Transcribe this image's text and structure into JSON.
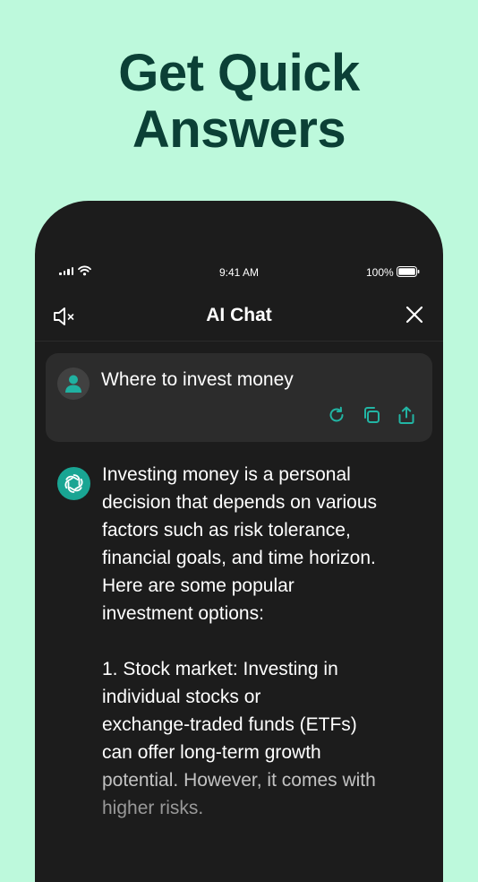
{
  "headline": {
    "line1": "Get Quick",
    "line2": "Answers"
  },
  "status_bar": {
    "time": "9:41 AM",
    "battery": "100%"
  },
  "nav": {
    "title": "AI Chat"
  },
  "user_message": {
    "text": "Where to invest money"
  },
  "ai_message": {
    "intro_lines": [
      "Investing money is a personal",
      "decision that depends on various",
      "factors such as risk tolerance,",
      "financial goals, and time horizon.",
      "Here are some popular",
      "investment options:"
    ],
    "item_lines": [
      "1. Stock market: Investing in",
      "individual stocks or",
      "exchange-traded funds (ETFs)",
      "can offer long-term growth",
      "potential. However, it comes with",
      "higher risks."
    ]
  },
  "colors": {
    "background": "#bdf9dc",
    "headline": "#0b4036",
    "phone": "#1c1c1c",
    "card": "#2c2c2c",
    "accent": "#19a593",
    "icon_accent": "#22b5a4"
  },
  "icons": {
    "nav_left": "speaker-mute-icon",
    "nav_right": "close-icon",
    "actions": [
      "refresh-icon",
      "copy-icon",
      "share-icon"
    ],
    "ai_logo": "ai-knot-logo-icon"
  }
}
